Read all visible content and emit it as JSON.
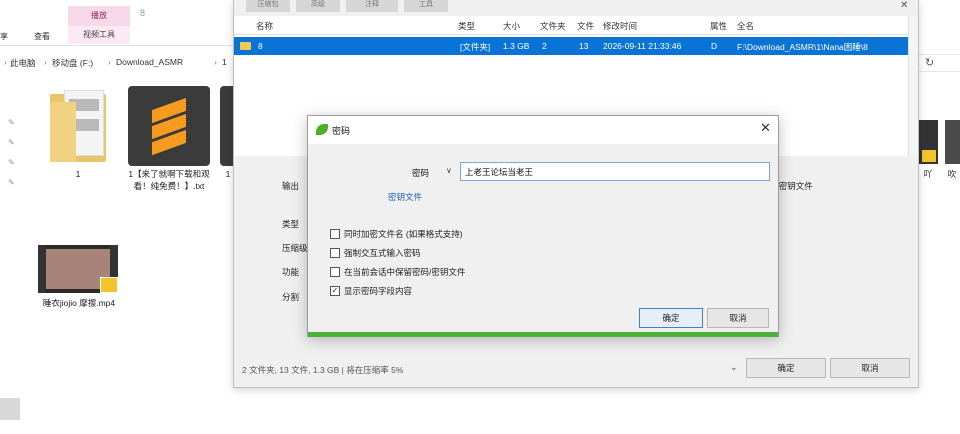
{
  "explorer": {
    "context_tab": "播放",
    "context_tab_group": "视频工具",
    "context_num": "8",
    "tab_file": "享",
    "tab_view": "查看",
    "breadcrumb": [
      "此电脑",
      "移动盘 (F:)",
      "Download_ASMR",
      "1"
    ],
    "items": [
      {
        "label": "1",
        "type": "folder"
      },
      {
        "label": "1【来了就啊下载和观看！纯免费！】.txt",
        "type": "text"
      },
      {
        "label": "1",
        "type": "partial"
      },
      {
        "label": "睡衣jiojio 摩擦.mp4",
        "type": "video"
      }
    ],
    "right_labels": [
      "吖",
      "吹"
    ]
  },
  "archive_dialog": {
    "tabs": [
      "压缩包",
      "高级",
      "注释",
      "工具"
    ],
    "columns": [
      "名称",
      "类型",
      "大小",
      "文件夹",
      "文件",
      "修改时间",
      "属性",
      "全名"
    ],
    "row": {
      "name": "8",
      "type": "[文件夹]",
      "size": "1.3 GB",
      "folders": "2",
      "files": "13",
      "modified": "2026-09-11 21:33:46",
      "attr": "D",
      "fullname": "F:\\Download_ASMR\\1\\Nana困睡\\8"
    },
    "labels": {
      "output": "输出",
      "type": "类型",
      "level": "压缩级别",
      "method": "功能",
      "split": "分割",
      "password_keyfile": "/ 密钥文件"
    },
    "status": "2 文件夹, 13 文件, 1.3 GB | 将在压缩率 5%",
    "ok": "确定",
    "cancel": "取消"
  },
  "password_dialog": {
    "title": "密码",
    "label": "密码",
    "value": "上老王论坛当老王",
    "keyfile_link": "密钥文件",
    "options": [
      {
        "label": "同时加密文件名 (如果格式支持)",
        "checked": false
      },
      {
        "label": "强制交互式输入密码",
        "checked": false
      },
      {
        "label": "在当前会话中保留密码/密钥文件",
        "checked": false
      },
      {
        "label": "显示密码字段内容",
        "checked": true
      }
    ],
    "ok": "确定",
    "cancel": "取消",
    "accent": "#4cb23a"
  }
}
